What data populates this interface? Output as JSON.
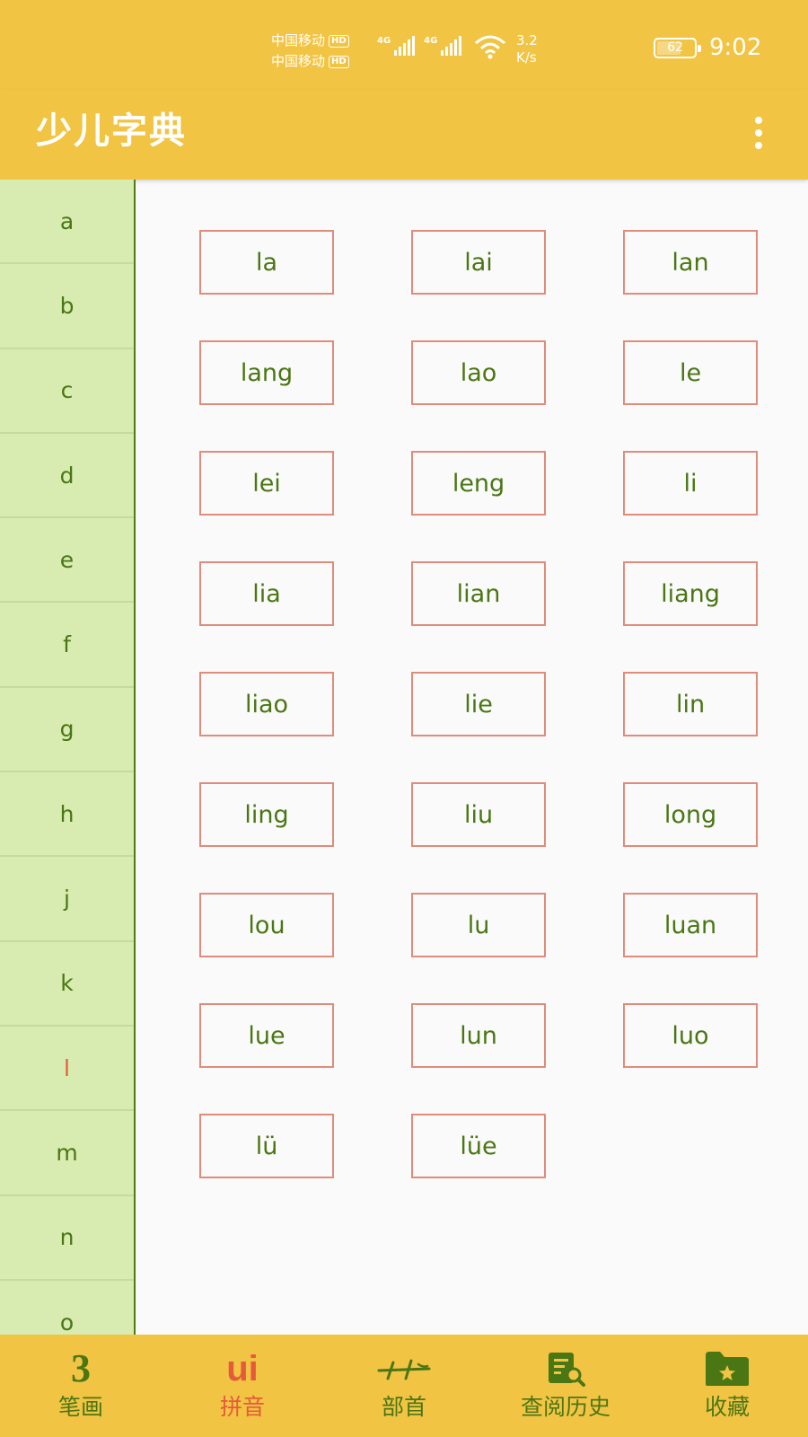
{
  "status_bar": {
    "carrier1": "中国移动",
    "carrier2": "中国移动",
    "hd": "HD",
    "net1": "4G",
    "net2": "4G",
    "speed_value": "3.2",
    "speed_unit": "K/s",
    "battery": "62",
    "time": "9:02"
  },
  "app_bar": {
    "title": "少儿字典"
  },
  "sidebar": {
    "letters": [
      "a",
      "b",
      "c",
      "d",
      "e",
      "f",
      "g",
      "h",
      "j",
      "k",
      "l",
      "m",
      "n",
      "o"
    ],
    "active": "l"
  },
  "pinyin_grid": [
    "la",
    "lai",
    "lan",
    "lang",
    "lao",
    "le",
    "lei",
    "leng",
    "li",
    "lia",
    "lian",
    "liang",
    "liao",
    "lie",
    "lin",
    "ling",
    "liu",
    "long",
    "lou",
    "lu",
    "luan",
    "lue",
    "lun",
    "luo",
    "lü",
    "lüe"
  ],
  "bottom_nav": {
    "items": [
      {
        "label": "笔画",
        "icon": "stroke-icon",
        "icon_text": "3"
      },
      {
        "label": "拼音",
        "icon": "pinyin-icon",
        "icon_text": "ui"
      },
      {
        "label": "部首",
        "icon": "radical-icon"
      },
      {
        "label": "查阅历史",
        "icon": "history-icon"
      },
      {
        "label": "收藏",
        "icon": "favorites-folder-icon"
      }
    ],
    "active_index": 1
  },
  "colors": {
    "primary": "#f2c443",
    "sidebar_bg": "#d8ebb0",
    "text_green": "#4b7614",
    "accent_red": "#e45b3c",
    "button_border": "#e08c7c"
  }
}
